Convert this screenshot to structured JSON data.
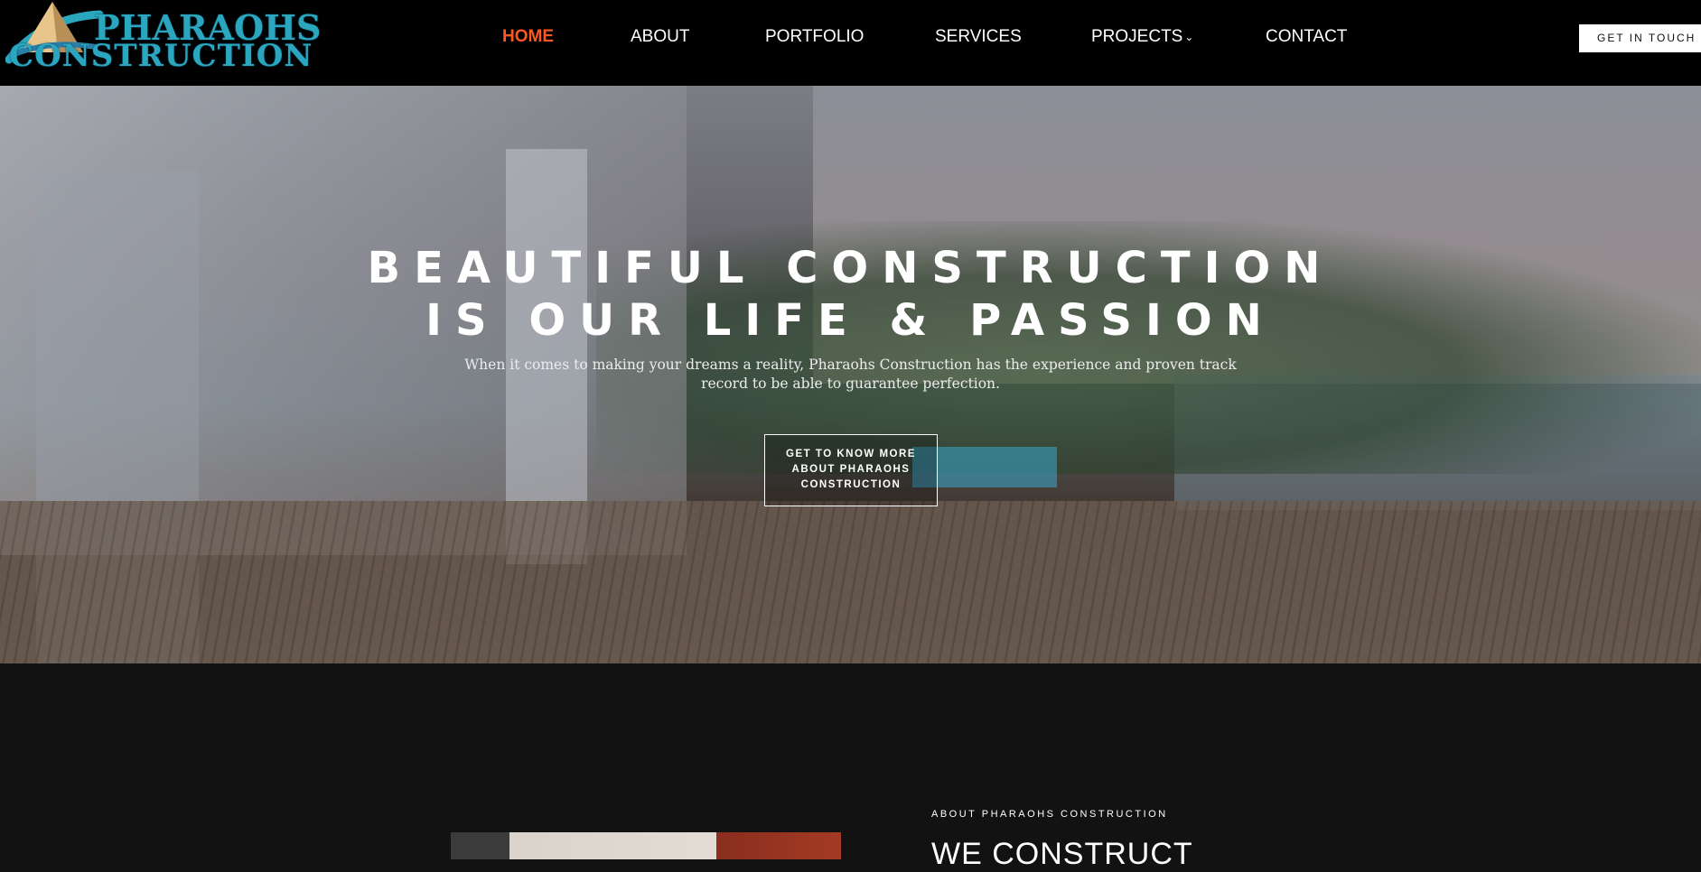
{
  "logo": {
    "line1": "HARAOHS",
    "line2": "ONSTRUCTION",
    "letter1": "P",
    "letter2": "C"
  },
  "nav": [
    {
      "label": "HOME",
      "active": true
    },
    {
      "label": "ABOUT"
    },
    {
      "label": "PORTFOLIO"
    },
    {
      "label": "SERVICES"
    },
    {
      "label": "PROJECTS",
      "chevron": "⌄"
    },
    {
      "label": "CONTACT"
    }
  ],
  "header_cta": "GET IN TOUCH",
  "hero": {
    "title_line1": "BEAUTIFUL CONSTRUCTION",
    "title_line2": "IS OUR LIFE & PASSION",
    "text": "When it comes to making your dreams a reality, Pharaohs Construction has the experience and proven track record to be able to guarantee perfection.",
    "button": "GET TO KNOW MORE ABOUT PHARAOHS CONSTRUCTION"
  },
  "about": {
    "eyebrow": "ABOUT PHARAOHS CONSTRUCTION",
    "heading": "WE CONSTRUCT"
  },
  "colors": {
    "accent": "#ff5722",
    "header_bg": "#000000",
    "section_bg": "#121212",
    "logo": "#2aa6bf"
  }
}
